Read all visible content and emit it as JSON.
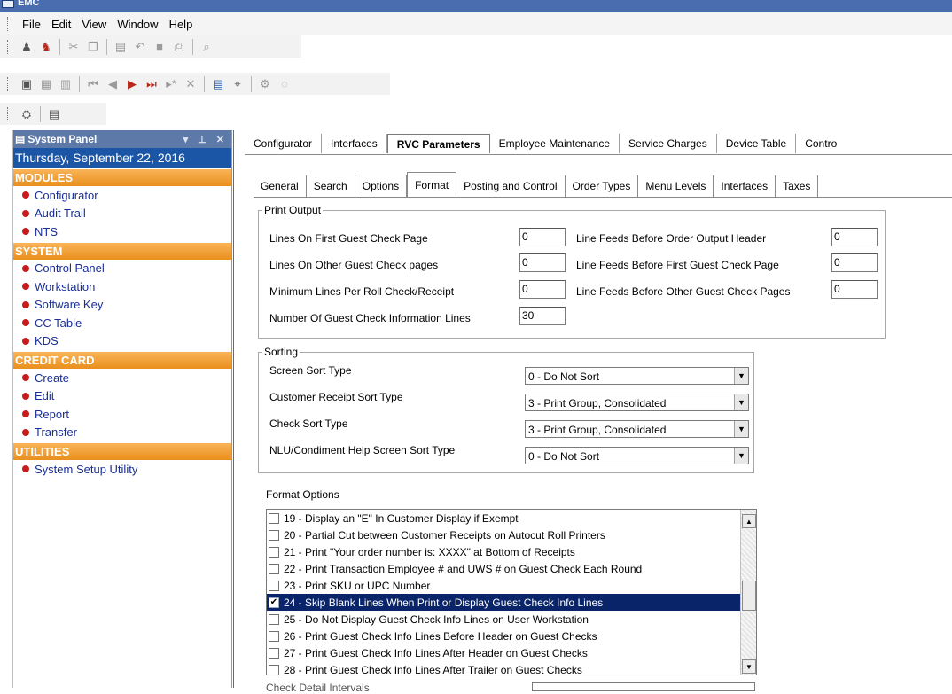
{
  "window": {
    "title": "EMC"
  },
  "menu": [
    "File",
    "Edit",
    "View",
    "Window",
    "Help"
  ],
  "side_panel": {
    "header": "System Panel",
    "date": "Thursday, September 22, 2016",
    "sections": [
      {
        "title": "MODULES",
        "items": [
          "Configurator",
          "Audit Trail",
          "NTS"
        ]
      },
      {
        "title": "SYSTEM",
        "items": [
          "Control Panel",
          "Workstation",
          "Software Key",
          "CC Table",
          "KDS"
        ]
      },
      {
        "title": "CREDIT CARD",
        "items": [
          "Create",
          "Edit",
          "Report",
          "Transfer"
        ]
      },
      {
        "title": "UTILITIES",
        "items": [
          "System Setup Utility"
        ]
      }
    ]
  },
  "top_tabs": [
    "Configurator",
    "Interfaces",
    "RVC Parameters",
    "Employee Maintenance",
    "Service Charges",
    "Device Table",
    "Contro"
  ],
  "top_tab_active": "RVC Parameters",
  "sub_tabs": [
    "General",
    "Search",
    "Options",
    "Format",
    "Posting and Control",
    "Order Types",
    "Menu Levels",
    "Interfaces",
    "Taxes"
  ],
  "sub_tab_active": "Format",
  "print_output": {
    "legend": "Print Output",
    "left": [
      {
        "label": "Lines On First Guest Check Page",
        "value": "0"
      },
      {
        "label": "Lines On Other Guest Check pages",
        "value": "0"
      },
      {
        "label": "Minimum Lines Per Roll Check/Receipt",
        "value": "0"
      },
      {
        "label": "Number Of Guest Check Information Lines",
        "value": "30"
      }
    ],
    "right": [
      {
        "label": "Line Feeds Before Order Output Header",
        "value": "0"
      },
      {
        "label": "Line Feeds Before First Guest Check Page",
        "value": "0"
      },
      {
        "label": "Line Feeds Before Other Guest Check Pages",
        "value": "0"
      }
    ]
  },
  "sorting": {
    "legend": "Sorting",
    "rows": [
      {
        "label": "Screen Sort Type",
        "value": "0 - Do Not Sort"
      },
      {
        "label": "Customer Receipt Sort Type",
        "value": "3 - Print Group, Consolidated"
      },
      {
        "label": "Check Sort Type",
        "value": "3 - Print Group, Consolidated"
      },
      {
        "label": "NLU/Condiment Help Screen Sort Type",
        "value": "0 - Do Not Sort"
      }
    ]
  },
  "format_options": {
    "title": "Format Options",
    "items": [
      {
        "label": "19 - Display an \"E\" In Customer Display if Exempt",
        "checked": false
      },
      {
        "label": "20 - Partial Cut between Customer Receipts on Autocut Roll Printers",
        "checked": false
      },
      {
        "label": "21 - Print \"Your order number is: XXXX\" at Bottom of Receipts",
        "checked": false
      },
      {
        "label": "22 - Print Transaction Employee # and UWS # on Guest Check Each Round",
        "checked": false
      },
      {
        "label": "23 - Print SKU or UPC Number",
        "checked": false
      },
      {
        "label": "24 - Skip Blank Lines When Print or Display Guest Check Info Lines",
        "checked": true,
        "selected": true
      },
      {
        "label": "25 - Do Not Display Guest Check Info Lines on User Workstation",
        "checked": false
      },
      {
        "label": "26 - Print Guest Check Info Lines Before Header on Guest Checks",
        "checked": false
      },
      {
        "label": "27 - Print Guest Check Info Lines After Header on Guest Checks",
        "checked": false
      },
      {
        "label": "28 - Print Guest Check Info Lines After Trailer on Guest Checks",
        "checked": false
      }
    ]
  },
  "cutoff_label": "Check Detail Intervals"
}
